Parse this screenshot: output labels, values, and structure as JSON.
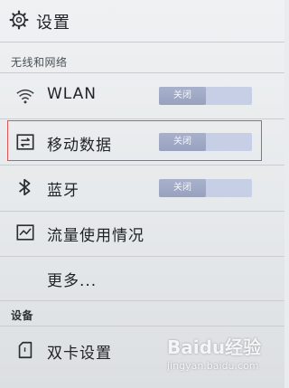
{
  "header": {
    "title": "设置",
    "icon": "gear-icon"
  },
  "sections": {
    "wireless": "无线和网络",
    "device": "设备"
  },
  "rows": [
    {
      "id": "wlan",
      "label": "WLAN",
      "icon": "wifi-icon",
      "toggle": "关闭"
    },
    {
      "id": "mobile-data",
      "label": "移动数据",
      "icon": "mobile-data-icon",
      "toggle": "关闭"
    },
    {
      "id": "bluetooth",
      "label": "蓝牙",
      "icon": "bluetooth-icon",
      "toggle": "关闭"
    },
    {
      "id": "data-usage",
      "label": "流量使用情况",
      "icon": "data-usage-icon"
    },
    {
      "id": "more",
      "label": "更多..."
    },
    {
      "id": "dual-sim",
      "label": "双卡设置",
      "icon": "sim-card-icon"
    }
  ],
  "watermark": {
    "brand": "Baidu经验",
    "url": "jingyan.baidu.com"
  },
  "colors": {
    "highlight_box": "#e05353",
    "toggle_track": "#c6cfe6",
    "toggle_knob": "#a8b1cc"
  }
}
